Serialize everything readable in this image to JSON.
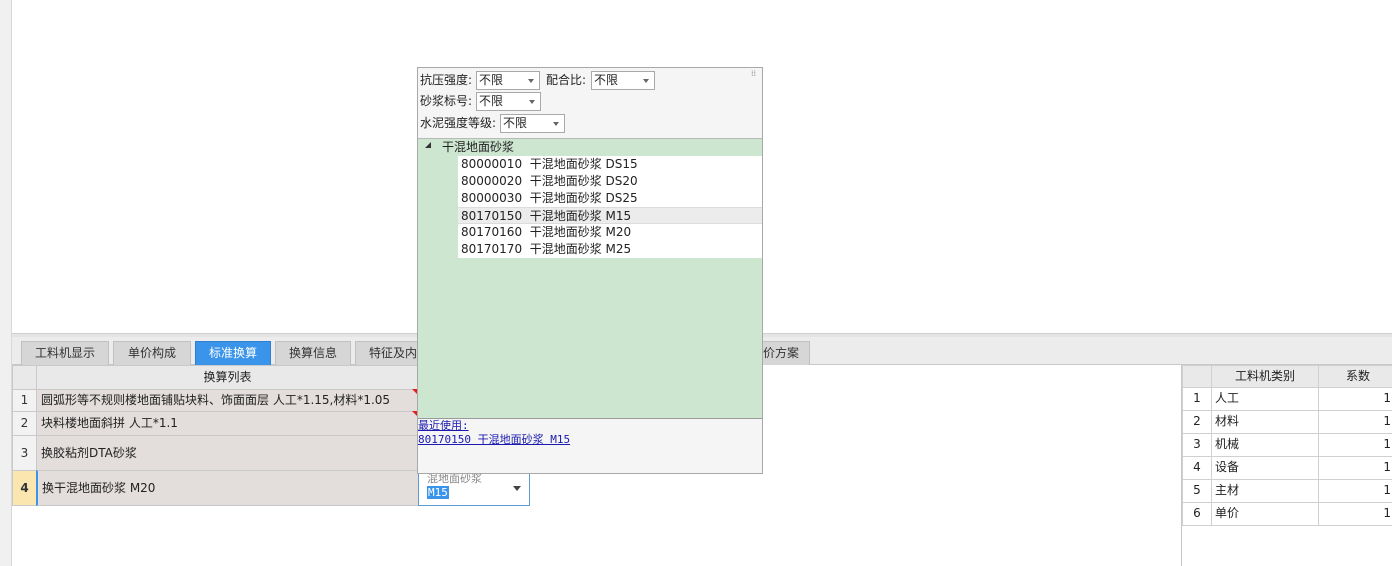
{
  "tabs": [
    {
      "label": "工料机显示",
      "active": false
    },
    {
      "label": "单价构成",
      "active": false
    },
    {
      "label": "标准换算",
      "active": true
    },
    {
      "label": "换算信息",
      "active": false
    },
    {
      "label": "特征及内",
      "active": false
    },
    {
      "label": "价方案",
      "active": false
    }
  ],
  "conversion_table": {
    "header": "换算列表",
    "rows": [
      {
        "num": "1",
        "text": "圆弧形等不规则楼地面铺贴块料、饰面面层 人工*1.15,材料*1.05"
      },
      {
        "num": "2",
        "text": "块料楼地面斜拼 人工*1.1"
      },
      {
        "num": "3",
        "text": "换胶粘剂DTA砂浆"
      },
      {
        "num": "4",
        "text": "换干混地面砂浆 M20"
      }
    ]
  },
  "combo": {
    "line1": "混地面砂浆",
    "line2": "M15"
  },
  "popup": {
    "filters": {
      "compressive_label": "抗压强度:",
      "compressive_value": "不限",
      "mix_label": "配合比:",
      "mix_value": "不限",
      "mortar_label": "砂浆标号:",
      "mortar_value": "不限",
      "cement_label": "水泥强度等级:",
      "cement_value": "不限"
    },
    "tree": {
      "root": "干混地面砂浆",
      "items": [
        {
          "code": "80000010",
          "name": "干混地面砂浆 DS15",
          "selected": false
        },
        {
          "code": "80000020",
          "name": "干混地面砂浆 DS20",
          "selected": false
        },
        {
          "code": "80000030",
          "name": "干混地面砂浆 DS25",
          "selected": false
        },
        {
          "code": "80170150",
          "name": "干混地面砂浆 M15",
          "selected": true
        },
        {
          "code": "80170160",
          "name": "干混地面砂浆 M20",
          "selected": false
        },
        {
          "code": "80170170",
          "name": "干混地面砂浆 M25",
          "selected": false
        }
      ]
    },
    "recent_label": "最近使用:",
    "recent_item": "80170150 干混地面砂浆 M15"
  },
  "category_table": {
    "headers": [
      "工料机类别",
      "系数"
    ],
    "rows": [
      {
        "num": "1",
        "category": "人工",
        "coef": "1"
      },
      {
        "num": "2",
        "category": "材料",
        "coef": "1"
      },
      {
        "num": "3",
        "category": "机械",
        "coef": "1"
      },
      {
        "num": "4",
        "category": "设备",
        "coef": "1"
      },
      {
        "num": "5",
        "category": "主材",
        "coef": "1"
      },
      {
        "num": "6",
        "category": "单价",
        "coef": "1"
      }
    ]
  },
  "colors": {
    "active_tab": "#3a94ea",
    "tree_bg": "#cde6d0",
    "row_bg": "#e3dedc",
    "link": "#1a1ab0"
  }
}
